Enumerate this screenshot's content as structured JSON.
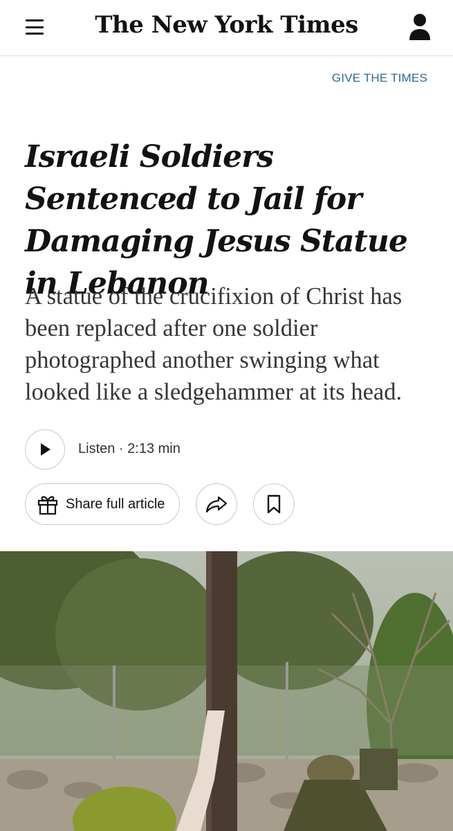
{
  "header": {
    "masthead": "The New York Times",
    "menu_icon": "hamburger-menu-icon",
    "account_icon": "user-account-icon"
  },
  "promo": {
    "give_label": "GIVE THE TIMES"
  },
  "article": {
    "headline": "Israeli Soldiers Sentenced to Jail for Damaging Jesus Statue in Lebanon",
    "summary": "A statue of the crucifixion of Christ has been replaced after one soldier photographed another swinging what looked like a sledgehammer at its head."
  },
  "audio": {
    "play_icon": "play-icon",
    "listen_label": "Listen · 2:13 min"
  },
  "actions": {
    "share_label": "Share full article",
    "gift_icon": "gift-icon",
    "forward_icon": "share-arrow-icon",
    "bookmark_icon": "bookmark-icon"
  },
  "colors": {
    "link": "#326891",
    "text": "#121212",
    "summary_text": "#363636",
    "border": "#c8c8c8"
  }
}
